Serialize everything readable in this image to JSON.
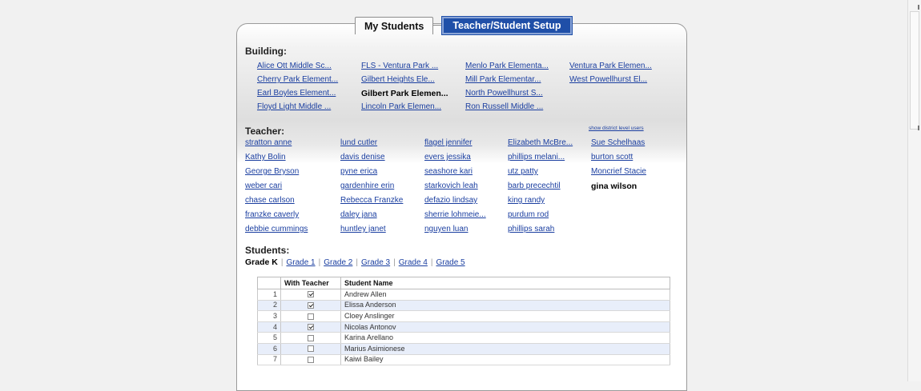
{
  "tabs": {
    "my_students": "My Students",
    "setup": "Teacher/Student Setup"
  },
  "building": {
    "label": "Building:",
    "items": [
      {
        "name": "Alice Ott Middle Sc...",
        "selected": false
      },
      {
        "name": "Cherry Park Element...",
        "selected": false
      },
      {
        "name": "Earl Boyles Element...",
        "selected": false
      },
      {
        "name": "Floyd Light Middle ...",
        "selected": false
      },
      {
        "name": "FLS - Ventura Park ...",
        "selected": false
      },
      {
        "name": "Gilbert Heights Ele...",
        "selected": false
      },
      {
        "name": "Gilbert Park Elemen...",
        "selected": true
      },
      {
        "name": "Lincoln Park Elemen...",
        "selected": false
      },
      {
        "name": "Menlo Park Elementa...",
        "selected": false
      },
      {
        "name": "Mill Park Elementar...",
        "selected": false
      },
      {
        "name": "North Powellhurst S...",
        "selected": false
      },
      {
        "name": "Ron Russell Middle ...",
        "selected": false
      },
      {
        "name": "Ventura Park Elemen...",
        "selected": false
      },
      {
        "name": "West Powellhurst El...",
        "selected": false
      }
    ]
  },
  "teacher": {
    "label": "Teacher:",
    "show_district_link": "show district level users",
    "items": [
      {
        "name": "stratton anne",
        "selected": false
      },
      {
        "name": "Kathy Bolin",
        "selected": false
      },
      {
        "name": "George Bryson",
        "selected": false
      },
      {
        "name": "weber cari",
        "selected": false
      },
      {
        "name": "chase carlson",
        "selected": false
      },
      {
        "name": "franzke caverly",
        "selected": false
      },
      {
        "name": "debbie cummings",
        "selected": false
      },
      {
        "name": "lund cutler",
        "selected": false
      },
      {
        "name": "davis denise",
        "selected": false
      },
      {
        "name": "pyne erica",
        "selected": false
      },
      {
        "name": "gardenhire erin",
        "selected": false
      },
      {
        "name": "Rebecca Franzke",
        "selected": false
      },
      {
        "name": "daley jana",
        "selected": false
      },
      {
        "name": "huntley janet",
        "selected": false
      },
      {
        "name": "flagel jennifer",
        "selected": false
      },
      {
        "name": "evers jessika",
        "selected": false
      },
      {
        "name": "seashore kari",
        "selected": false
      },
      {
        "name": "starkovich leah",
        "selected": false
      },
      {
        "name": "defazio lindsay",
        "selected": false
      },
      {
        "name": "sherrie lohmeie...",
        "selected": false
      },
      {
        "name": "nguyen luan",
        "selected": false
      },
      {
        "name": "Elizabeth McBre...",
        "selected": false
      },
      {
        "name": "phillips melani...",
        "selected": false
      },
      {
        "name": "utz patty",
        "selected": false
      },
      {
        "name": "barb precechtil",
        "selected": false
      },
      {
        "name": "king randy",
        "selected": false
      },
      {
        "name": "purdum rod",
        "selected": false
      },
      {
        "name": "phillips sarah",
        "selected": false
      },
      {
        "name": "Sue Schelhaas",
        "selected": false
      },
      {
        "name": "burton scott",
        "selected": false
      },
      {
        "name": "Moncrief Stacie",
        "selected": false
      },
      {
        "name": "gina wilson",
        "selected": true
      }
    ]
  },
  "students": {
    "label": "Students:",
    "grades": [
      {
        "label": "Grade K",
        "selected": true
      },
      {
        "label": "Grade 1",
        "selected": false
      },
      {
        "label": "Grade 2",
        "selected": false
      },
      {
        "label": "Grade 3",
        "selected": false
      },
      {
        "label": "Grade 4",
        "selected": false
      },
      {
        "label": "Grade 5",
        "selected": false
      }
    ],
    "table": {
      "headers": [
        "",
        "With Teacher",
        "Student Name"
      ],
      "rows": [
        {
          "num": "1",
          "checked": true,
          "name": "Andrew Allen"
        },
        {
          "num": "2",
          "checked": true,
          "name": "Elissa Anderson"
        },
        {
          "num": "3",
          "checked": false,
          "name": "Cloey Anslinger"
        },
        {
          "num": "4",
          "checked": true,
          "name": "Nicolas Antonov"
        },
        {
          "num": "5",
          "checked": false,
          "name": "Karina Arellano"
        },
        {
          "num": "6",
          "checked": false,
          "name": "Marius Asimionese"
        },
        {
          "num": "7",
          "checked": false,
          "name": "Kaiwi Bailey"
        }
      ]
    }
  }
}
